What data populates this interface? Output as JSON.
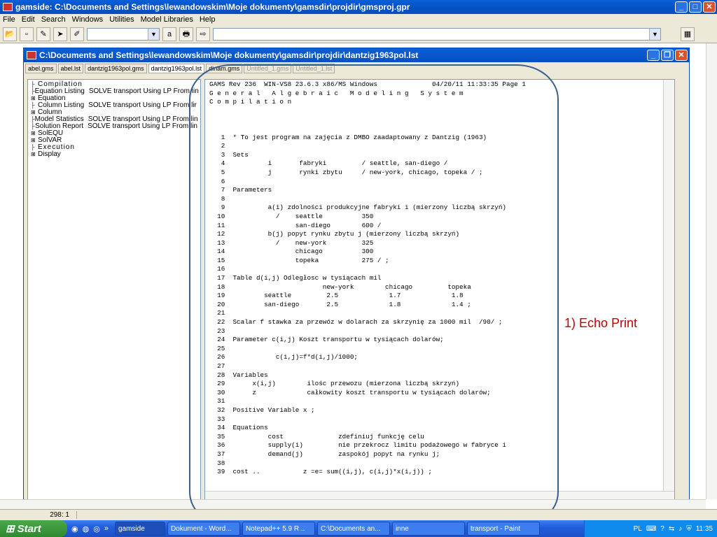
{
  "window": {
    "title": "gamside: C:\\Documents and Settings\\lewandowskim\\Moje dokumenty\\gamsdir\\projdir\\gmsproj.gpr"
  },
  "menu": [
    "File",
    "Edit",
    "Search",
    "Windows",
    "Utilities",
    "Model Libraries",
    "Help"
  ],
  "toolbar": {
    "combo_small_value": "",
    "combo_large_value": ""
  },
  "inner": {
    "title": "C:\\Documents and Settings\\lewandowskim\\Moje dokumenty\\gamsdir\\projdir\\dantzig1963pol.lst",
    "tabs": [
      "abel.gms",
      "abel.lst",
      "dantzig1963pol.gms",
      "dantzig1963pol.lst",
      "dinam.gms",
      "Untitled_1.gms",
      "Untitled_1.lst"
    ]
  },
  "tree": [
    {
      "exp": "",
      "label": "Compilation",
      "desc": "",
      "spaced": true
    },
    {
      "exp": "",
      "label": "Equation Listing",
      "desc": "SOLVE transport Using LP From lin"
    },
    {
      "exp": "+",
      "label": "Equation",
      "desc": ""
    },
    {
      "exp": "",
      "label": "Column Listing",
      "desc": "SOLVE transport Using LP From lir"
    },
    {
      "exp": "+",
      "label": "Column",
      "desc": ""
    },
    {
      "exp": "",
      "label": "Model Statistics",
      "desc": "SOLVE transport Using LP From lin"
    },
    {
      "exp": "",
      "label": "Solution Report",
      "desc": "SOLVE transport Using LP From lin"
    },
    {
      "exp": "+",
      "label": "SolEQU",
      "desc": ""
    },
    {
      "exp": "+",
      "label": "SolVAR",
      "desc": ""
    },
    {
      "exp": "",
      "label": "Execution",
      "desc": "",
      "spaced": true
    },
    {
      "exp": "+",
      "label": "Display",
      "desc": ""
    }
  ],
  "code": {
    "header": [
      "GAMS Rev 236  WIN-VS8 23.6.3 x86/MS Windows              04/20/11 11:33:35 Page 1",
      "G e n e r a l   A l g e b r a i c   M o d e l i n g   S y s t e m",
      "C o m p i l a t i o n"
    ],
    "lines": [
      "",
      "",
      "",
      "   1  * To jest program na zajęcia z DMBO zaadaptowany z Dantzig (1963)",
      "   2",
      "   3  Sets",
      "   4           i       fabryki         / seattle, san-diego /",
      "   5           j       rynki zbytu     / new-york, chicago, topeka / ;",
      "   6",
      "   7  Parameters",
      "   8",
      "   9           a(i) zdolności produkcyjne fabryki i (mierzony liczbą skrzyń)",
      "  10             /    seattle          350",
      "  11                  san-diego        600 /",
      "  12           b(j) popyt rynku zbytu j (mierzony liczbą skrzyń)",
      "  13             /    new-york         325",
      "  14                  chicago          300",
      "  15                  topeka           275 / ;",
      "  16",
      "  17  Table d(i,j) Odległosc w tysiącach mil",
      "  18                         new-york        chicago         topeka",
      "  19          seattle         2.5             1.7             1.8",
      "  20          san-diego       2.5             1.8             1.4 ;",
      "  21",
      "  22  Scalar f stawka za przewóz w dolarach za skrzynię za 1000 mil  /90/ ;",
      "  23",
      "  24  Parameter c(i,j) Koszt transportu w tysiącach dolarów;",
      "  25",
      "  26             c(i,j)=f*d(i,j)/1000;",
      "  27",
      "  28  Variables",
      "  29       x(i,j)        ilośc przewozu (mierzona liczbą skrzyń)",
      "  30       z             całkowity koszt transportu w tysiącach dolarów;",
      "  31",
      "  32  Positive Variable x ;",
      "  33",
      "  34  Equations",
      "  35           cost              zdefiniuj funkcję celu",
      "  36           supply(i)         nie przekrocz limitu podażowego w fabryce i",
      "  37           demand(j)         zaspokój popyt na rynku j;",
      "  38",
      "  39  cost ..           z =e= sum((i,j), c(i,j)*x(i,j)) ;"
    ]
  },
  "annotation": "1) Echo Print",
  "status": {
    "position": "298: 1"
  },
  "taskbar": {
    "start": "Start",
    "quick_chevron": "»",
    "tasks": [
      {
        "label": "gamside",
        "active": true
      },
      {
        "label": "Dokument - Word...",
        "active": false
      },
      {
        "label": "Notepad++ 5.9 R...",
        "active": false
      },
      {
        "label": "C:\\Documents an...",
        "active": false
      },
      {
        "label": "inne",
        "active": false
      },
      {
        "label": "transport - Paint",
        "active": false
      }
    ],
    "lang": "PL",
    "clock": "11:35"
  },
  "colors": {
    "annotation": "#c00000",
    "oval": "#3a5f8c",
    "titlebar": "#0a5fd8"
  }
}
